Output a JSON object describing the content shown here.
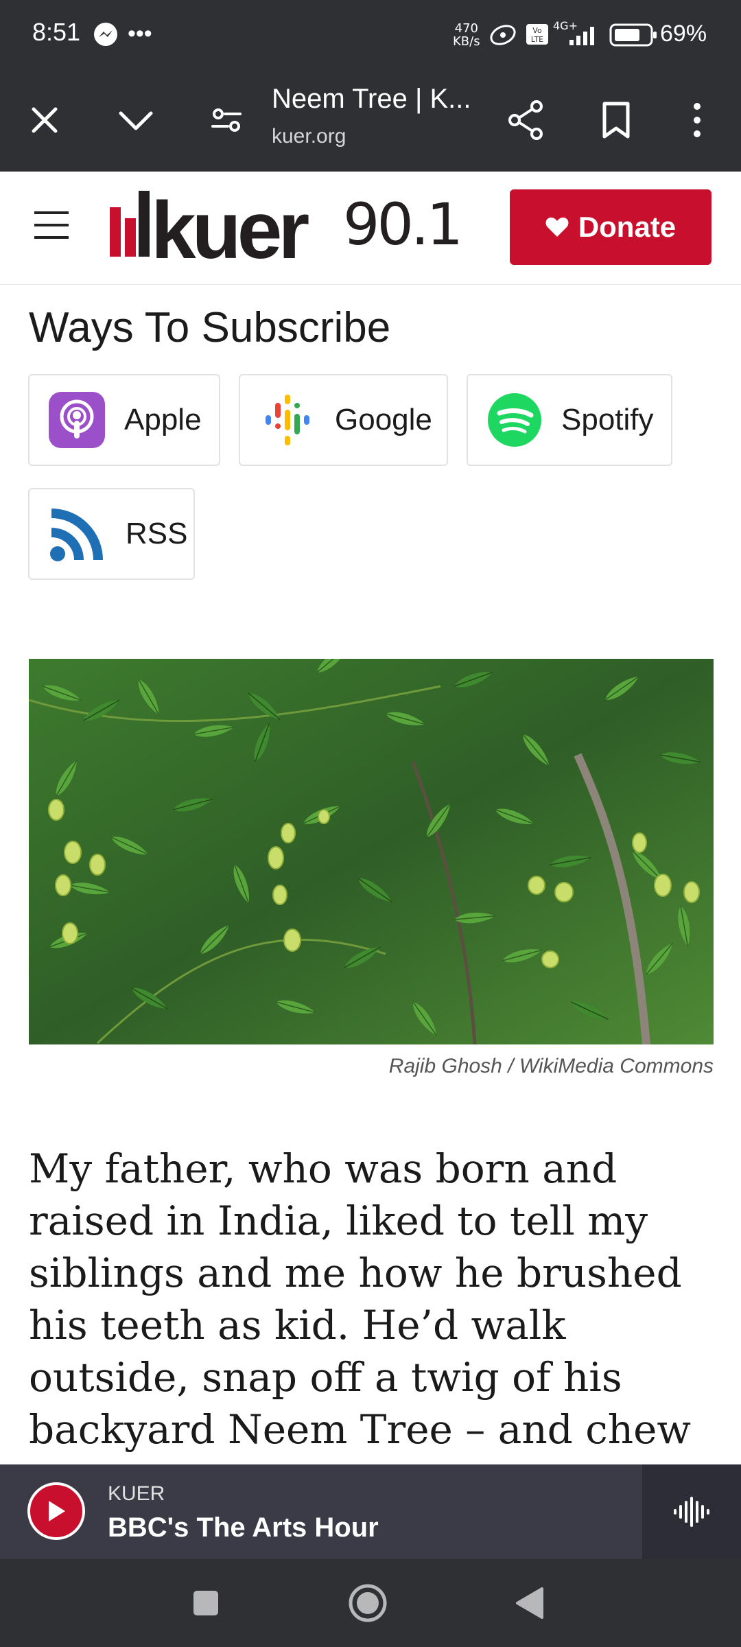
{
  "status": {
    "time": "8:51",
    "net_speed_top": "470",
    "net_speed_bottom": "KB/s",
    "network_label": "4G+",
    "battery": "69%"
  },
  "browser": {
    "title": "Neem Tree | K...",
    "url": "kuer.org"
  },
  "site": {
    "logo_text": "kuer",
    "logo_freq": "90.1",
    "donate_label": "Donate"
  },
  "subscribe": {
    "heading": "Ways To Subscribe",
    "options": [
      {
        "label": "Apple"
      },
      {
        "label": "Google"
      },
      {
        "label": "Spotify"
      },
      {
        "label": "RSS"
      }
    ]
  },
  "image": {
    "credit": "Rajib Ghosh / WikiMedia Commons"
  },
  "story": {
    "text": "My father, who was born and raised in India, liked to tell my siblings and me how he brushed his teeth as kid. He’d walk outside, snap off a twig of his backyard Neem Tree – and chew on it!"
  },
  "player": {
    "station": "KUER",
    "show": "BBC's The Arts Hour"
  },
  "colors": {
    "brand_red": "#c8102e",
    "toolbar_bg": "#2f3034",
    "player_bg": "#3a3b46"
  }
}
